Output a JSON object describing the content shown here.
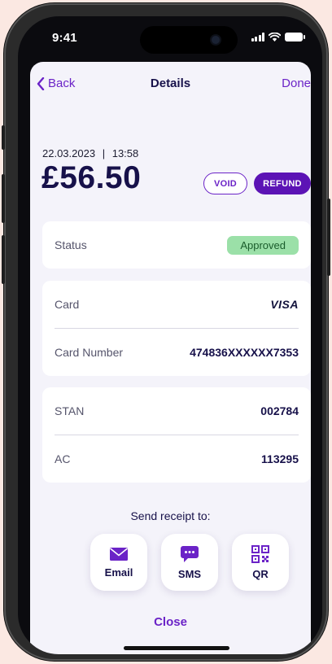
{
  "status_bar": {
    "time": "9:41"
  },
  "nav": {
    "back_label": "Back",
    "title": "Details",
    "done_label": "Done"
  },
  "transaction": {
    "date": "22.03.2023",
    "separator": "|",
    "time": "13:58",
    "amount": "£56.50",
    "void_label": "VOID",
    "refund_label": "REFUND"
  },
  "status_card": {
    "label": "Status",
    "value": "Approved"
  },
  "card_info": {
    "card_label": "Card",
    "card_brand": "VISA",
    "number_label": "Card Number",
    "number_value": "474836XXXXXX7353"
  },
  "codes": {
    "stan_label": "STAN",
    "stan_value": "002784",
    "ac_label": "AC",
    "ac_value": "113295"
  },
  "receipt": {
    "title": "Send receipt to:",
    "options": [
      {
        "label": "Email",
        "icon": "envelope-icon"
      },
      {
        "label": "SMS",
        "icon": "chat-bubble-icon"
      },
      {
        "label": "QR",
        "icon": "qr-code-icon"
      }
    ]
  },
  "close_label": "Close",
  "colors": {
    "accent": "#6b23c7",
    "primary_text": "#17114a",
    "approved_bg": "#9be0a8",
    "sheet_bg": "#f4f3fa"
  }
}
